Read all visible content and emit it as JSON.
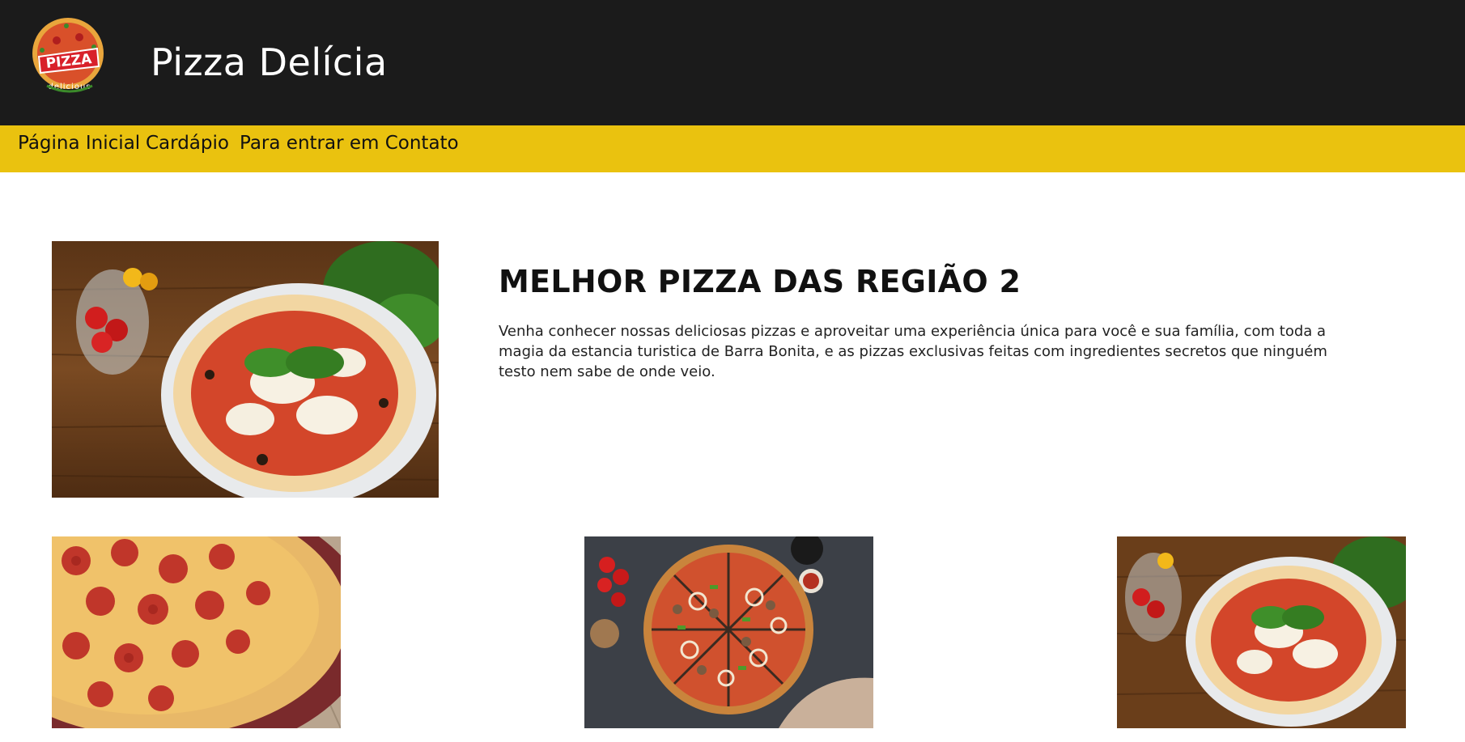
{
  "header": {
    "title": "Pizza Delícia",
    "logo": {
      "text_top": "PIZZA",
      "text_bottom": "delicious"
    }
  },
  "nav": {
    "items": [
      {
        "label": "Página Inicial"
      },
      {
        "label": "Cardápio"
      },
      {
        "label": "Para entrar em Contato"
      }
    ]
  },
  "hero": {
    "title": "MELHOR PIZZA DAS REGIÃO 2",
    "description": "Venha conhecer nossas deliciosas pizzas e aproveitar uma experiência única para você e sua família, com toda a magia da estancia turistica de Barra Bonita, e as pizzas exclusivas feitas com ingredientes secretos que ninguém testo nem sabe de onde veio."
  },
  "colors": {
    "header_bg": "#1b1b1b",
    "nav_bg": "#eac20f",
    "page_bg": "#ffffff"
  }
}
